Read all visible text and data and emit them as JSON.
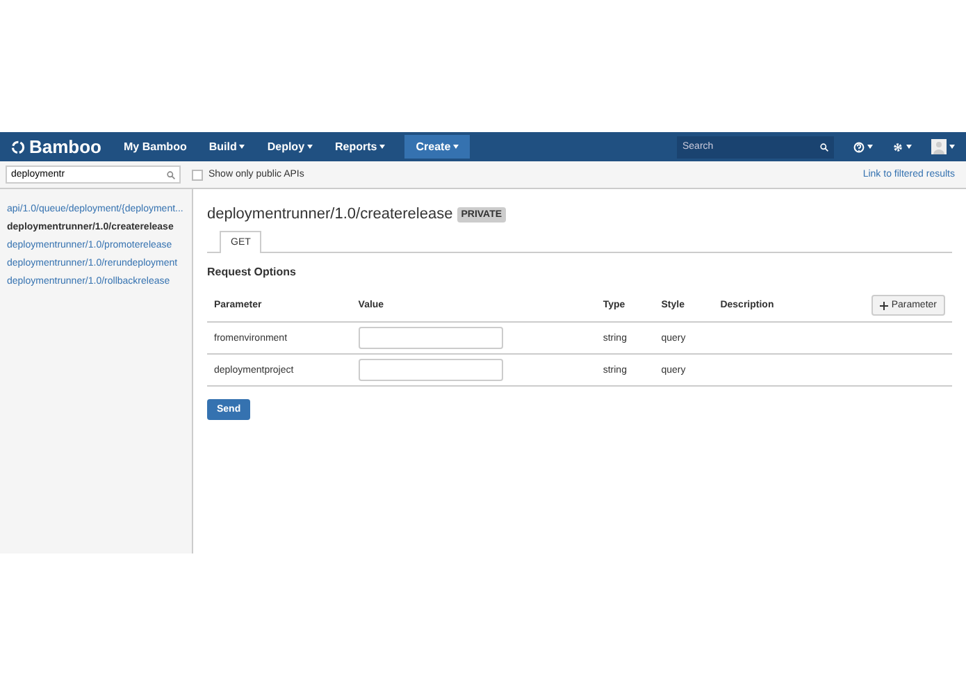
{
  "navbar": {
    "logo": "Bamboo",
    "menu": [
      {
        "label": "My Bamboo",
        "dropdown": false
      },
      {
        "label": "Build",
        "dropdown": true
      },
      {
        "label": "Deploy",
        "dropdown": true
      },
      {
        "label": "Reports",
        "dropdown": true
      }
    ],
    "create": "Create",
    "search": {
      "placeholder": "Search"
    }
  },
  "filter": {
    "value": "deploymentr",
    "public_only": {
      "label": "Show only public APIs",
      "checked": false
    },
    "link": "Link to filtered results"
  },
  "sidebar": {
    "items": [
      {
        "label": "api/1.0/queue/deployment/{deployment...",
        "selected": false
      },
      {
        "label": "deploymentrunner/1.0/createrelease",
        "selected": true
      },
      {
        "label": "deploymentrunner/1.0/promoterelease",
        "selected": false
      },
      {
        "label": "deploymentrunner/1.0/rerundeployment",
        "selected": false
      },
      {
        "label": "deploymentrunner/1.0/rollbackrelease",
        "selected": false
      }
    ]
  },
  "main": {
    "title": "deploymentrunner/1.0/createrelease",
    "badge": "PRIVATE",
    "tabs": [
      {
        "label": "GET",
        "selected": true
      }
    ],
    "section": "Request Options",
    "table": {
      "columns": [
        "Parameter",
        "Value",
        "Type",
        "Style",
        "Description"
      ],
      "add_button": "Parameter",
      "rows": [
        {
          "name": "fromenvironment",
          "type": "string",
          "style": "query"
        },
        {
          "name": "deploymentproject",
          "type": "string",
          "style": "query"
        }
      ]
    },
    "send": "Send"
  }
}
